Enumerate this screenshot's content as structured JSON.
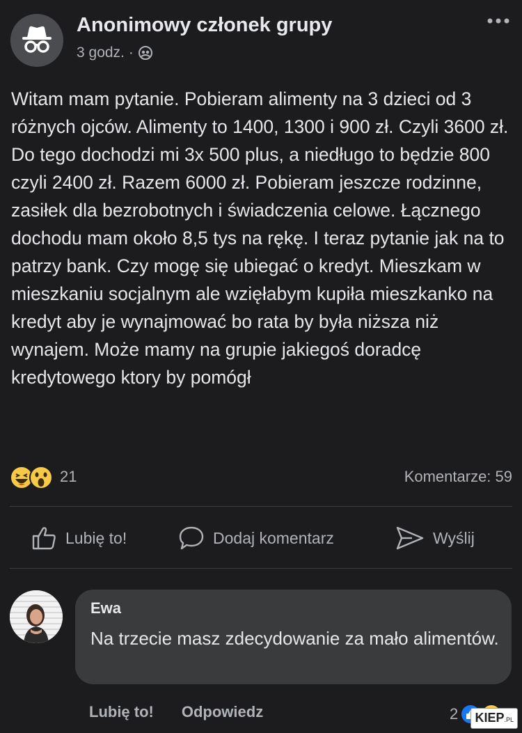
{
  "post": {
    "author": "Anonimowy członek grupy",
    "time": "3 godz.",
    "separator": "·",
    "body": "Witam mam pytanie. Pobieram alimenty na 3 dzieci od 3 różnych ojców. Alimenty to 1400, 1300 i 900 zł. Czyli 3600 zł. Do tego dochodzi mi 3x 500 plus, a niedługo to będzie 800 czyli 2400 zł. Razem 6000 zł. Pobieram jeszcze rodzinne, zasiłek dla bezrobotnych i świadczenia celowe. Łącznego dochodu mam około 8,5 tys na rękę. I teraz pytanie jak na to patrzy bank. Czy mogę się ubiegać o kredyt. Mieszkam w mieszkaniu socjalnym ale wzięłabym kupiła mieszkanko na kredyt aby je wynajmować bo rata by była niższa niż wynajem. Może mamy na grupie jakiegoś doradcę kredytowego ktory by pomógł",
    "reactions_count": "21",
    "comments_count": "Komentarze: 59"
  },
  "actions": {
    "like": "Lubię to!",
    "comment": "Dodaj komentarz",
    "send": "Wyślij"
  },
  "comment": {
    "author": "Ewa",
    "text": "Na trzecie masz zdecydowanie za mało alimentów.",
    "like": "Lubię to!",
    "reply": "Odpowiedz",
    "reactions_count": "2"
  },
  "watermark": {
    "text": "KIEP",
    "suffix": ".PL"
  },
  "icons": {
    "avatar": "incognito-icon",
    "privacy": "group-members-icon",
    "more": "more-dots-icon",
    "reaction_1": "haha-reaction-icon",
    "reaction_2": "wow-reaction-icon",
    "like": "thumbs-up-icon",
    "comment": "comment-bubble-icon",
    "send": "send-icon",
    "comment_reaction_1": "like-reaction-icon",
    "comment_reaction_2": "haha-reaction-icon"
  },
  "colors": {
    "background": "#1c1c1e",
    "text": "#e6e7ea",
    "secondary_text": "#b0b3b8",
    "bubble": "#3a3b3c",
    "divider": "#3a3b3e",
    "like_blue": "#1877f2",
    "reaction_yellow": "#f7c948"
  }
}
